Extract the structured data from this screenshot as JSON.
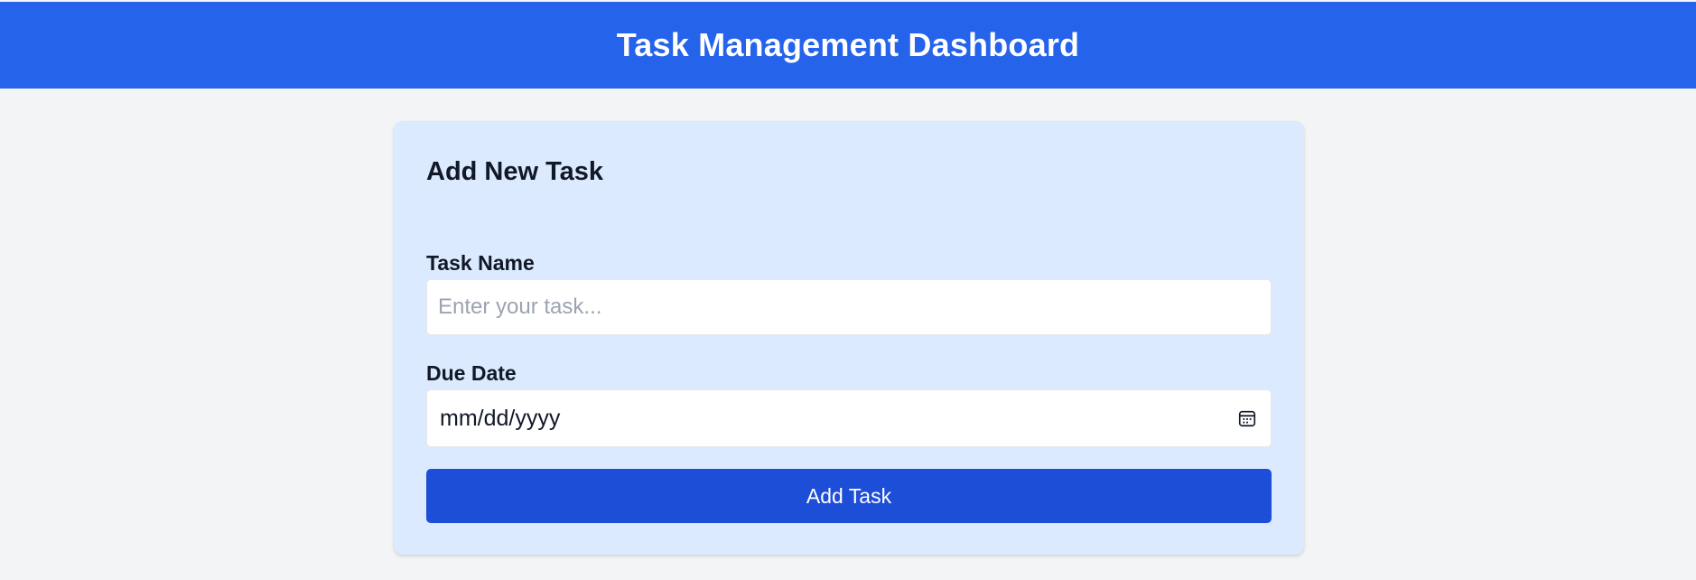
{
  "header": {
    "title": "Task Management Dashboard"
  },
  "form": {
    "title": "Add New Task",
    "task_name": {
      "label": "Task Name",
      "placeholder": "Enter your task...",
      "value": ""
    },
    "due_date": {
      "label": "Due Date",
      "placeholder": "mm/dd/yyyy",
      "icon": "calendar-icon"
    },
    "submit_label": "Add Task"
  },
  "colors": {
    "header_background": "#2563eb",
    "page_background": "#f3f4f6",
    "card_background": "#dbeafe",
    "button_background": "#1d4ed8",
    "placeholder_text": "#9ca3af"
  }
}
